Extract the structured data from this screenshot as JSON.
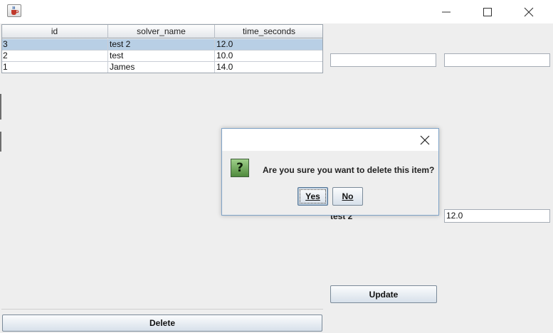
{
  "window": {
    "app_icon": "java-cup-icon",
    "controls": [
      "minimize-icon",
      "maximize-icon",
      "close-icon"
    ]
  },
  "table": {
    "columns": [
      "id",
      "solver_name",
      "time_seconds"
    ],
    "rows": [
      {
        "id": "3",
        "solver_name": "test 2",
        "time_seconds": "12.0",
        "selected": true
      },
      {
        "id": "2",
        "solver_name": "test",
        "time_seconds": "10.0",
        "selected": false
      },
      {
        "id": "1",
        "solver_name": "James",
        "time_seconds": "14.0",
        "selected": false
      }
    ],
    "selection_color": "#b8cfe5"
  },
  "actions": {
    "delete_label": "Delete",
    "update_label": "Update"
  },
  "form": {
    "field_a_value": "",
    "field_b_value": "",
    "name_label": "test 2",
    "time_value": "12.0"
  },
  "dialog": {
    "icon": "question-icon",
    "icon_glyph": "?",
    "message": "Are you sure you want to delete this item?",
    "yes_label": "Yes",
    "no_label": "No"
  }
}
